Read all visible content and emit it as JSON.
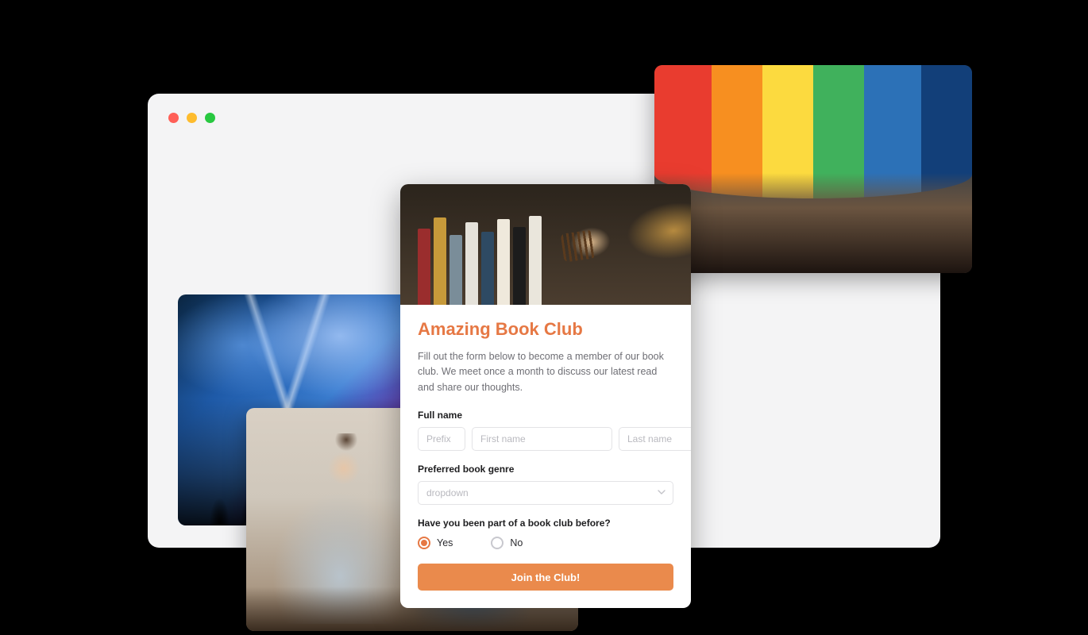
{
  "form": {
    "title": "Amazing Book Club",
    "description": "Fill out the form below to become a member of our book club. We meet once a month to discuss our latest read and share our thoughts.",
    "full_name_label": "Full name",
    "prefix_placeholder": "Prefix",
    "first_placeholder": "First name",
    "last_placeholder": "Last name",
    "genre_label": "Preferred book genre",
    "genre_placeholder": "dropdown",
    "prior_label": "Have you been part of a book club before?",
    "option_yes": "Yes",
    "option_no": "No",
    "submit_label": "Join the Club!"
  },
  "colors": {
    "accent": "#e67844"
  }
}
